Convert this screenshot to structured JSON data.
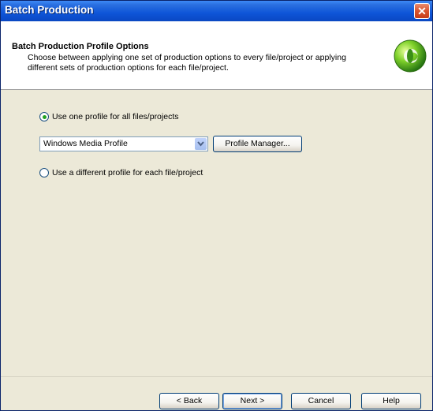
{
  "window": {
    "title": "Batch Production"
  },
  "header": {
    "title": "Batch Production Profile Options",
    "description": "Choose between applying one set of production options to every file/project or applying different sets of production options for each file/project."
  },
  "options": {
    "one_profile_label": "Use one profile for all files/projects",
    "different_profile_label": "Use a different profile for each file/project",
    "selected": "one_profile"
  },
  "profile_select": {
    "value": "Windows Media Profile"
  },
  "buttons": {
    "profile_manager": "Profile Manager...",
    "back": "< Back",
    "next": "Next >",
    "cancel": "Cancel",
    "help": "Help"
  },
  "colors": {
    "titlebar": "#0e55d8",
    "dialog_bg": "#ece9d8",
    "radio_dot": "#21a121"
  },
  "icons": {
    "close": "close-icon",
    "logo": "green-orb-logo-icon",
    "dropdown": "chevron-down-icon"
  }
}
